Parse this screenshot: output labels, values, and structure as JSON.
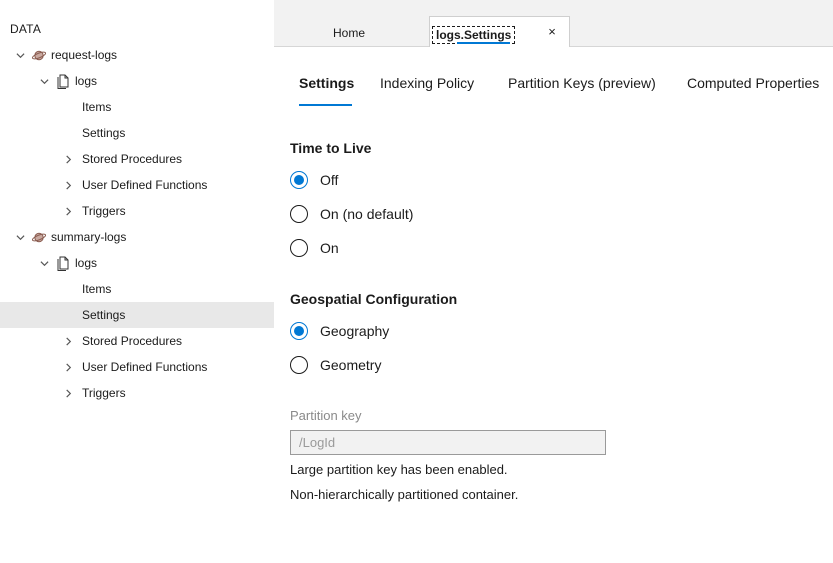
{
  "sidebar": {
    "header": "DATA",
    "tree": [
      {
        "label": "request-logs",
        "kind": "database",
        "chevron": "down"
      },
      {
        "label": "logs",
        "kind": "container",
        "chevron": "down"
      },
      {
        "label": "Items",
        "kind": "leaf"
      },
      {
        "label": "Settings",
        "kind": "leaf"
      },
      {
        "label": "Stored Procedures",
        "kind": "group",
        "chevron": "right"
      },
      {
        "label": "User Defined Functions",
        "kind": "group",
        "chevron": "right"
      },
      {
        "label": "Triggers",
        "kind": "group",
        "chevron": "right"
      },
      {
        "label": "summary-logs",
        "kind": "database",
        "chevron": "down"
      },
      {
        "label": "logs",
        "kind": "container",
        "chevron": "down"
      },
      {
        "label": "Items",
        "kind": "leaf"
      },
      {
        "label": "Settings",
        "kind": "leaf",
        "selected": true
      },
      {
        "label": "Stored Procedures",
        "kind": "group",
        "chevron": "right"
      },
      {
        "label": "User Defined Functions",
        "kind": "group",
        "chevron": "right"
      },
      {
        "label": "Triggers",
        "kind": "group",
        "chevron": "right"
      }
    ]
  },
  "tabs": {
    "home": "Home",
    "active": "logs.Settings",
    "close_icon": "×"
  },
  "subtabs": [
    "Settings",
    "Indexing Policy",
    "Partition Keys (preview)",
    "Computed Properties"
  ],
  "ttl": {
    "title": "Time to Live",
    "options": [
      "Off",
      "On (no default)",
      "On"
    ],
    "selected": "Off"
  },
  "geo": {
    "title": "Geospatial Configuration",
    "options": [
      "Geography",
      "Geometry"
    ],
    "selected": "Geography"
  },
  "partition": {
    "label": "Partition key",
    "value": "/LogId",
    "note1": "Large partition key has been enabled.",
    "note2": "Non-hierarchically partitioned container."
  },
  "colors": {
    "accent": "#0078d4",
    "selected_row": "#e8e8e8",
    "tabbar": "#f2f2f2"
  }
}
